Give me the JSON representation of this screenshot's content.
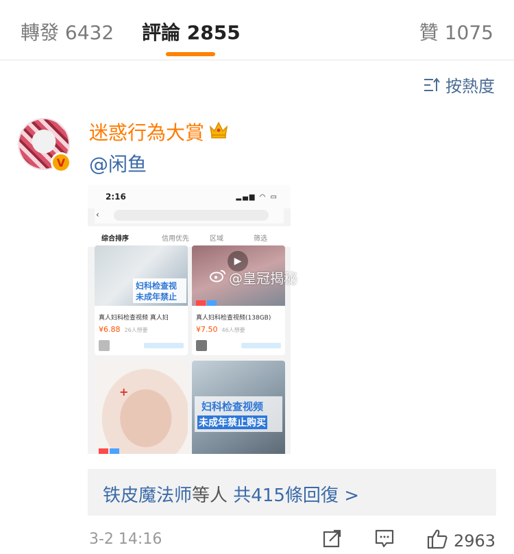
{
  "tabs": {
    "forward_label": "轉發 6432",
    "comments_label": "評論 2855",
    "likes_label": "贊 1075"
  },
  "sort": {
    "label": "按熱度"
  },
  "comment": {
    "username": "迷惑行為大賞",
    "mention": "@闲鱼",
    "verified_badge": "V",
    "time": "3-2 14:16",
    "like_count": "2963"
  },
  "screenshot": {
    "status_time": "2:16",
    "filter": {
      "sort": "综合排序",
      "credit": "信用优先",
      "area": "区域",
      "filter": "筛选"
    },
    "cards": [
      {
        "overlay_line1": "妇科检查视",
        "overlay_line2": "未成年禁止",
        "caption": "真人妇科检查视频  真人妇",
        "price": "¥6.88",
        "sold": "26人想要"
      },
      {
        "caption": "真人妇科检查视频(138GB)",
        "price": "¥7.50",
        "sold": "46人想要"
      },
      {},
      {
        "overlay_line1": "妇科检查视频",
        "overlay_line2": "未成年禁止购买"
      }
    ],
    "watermark": "@皇冠揭秘"
  },
  "replies": {
    "name": "铁皮魔法师",
    "middle": "等人",
    "count": "共415條回復 >"
  },
  "colors": {
    "accent": "#ff8200",
    "link": "#3a6aa8",
    "username": "#ff7a00"
  }
}
